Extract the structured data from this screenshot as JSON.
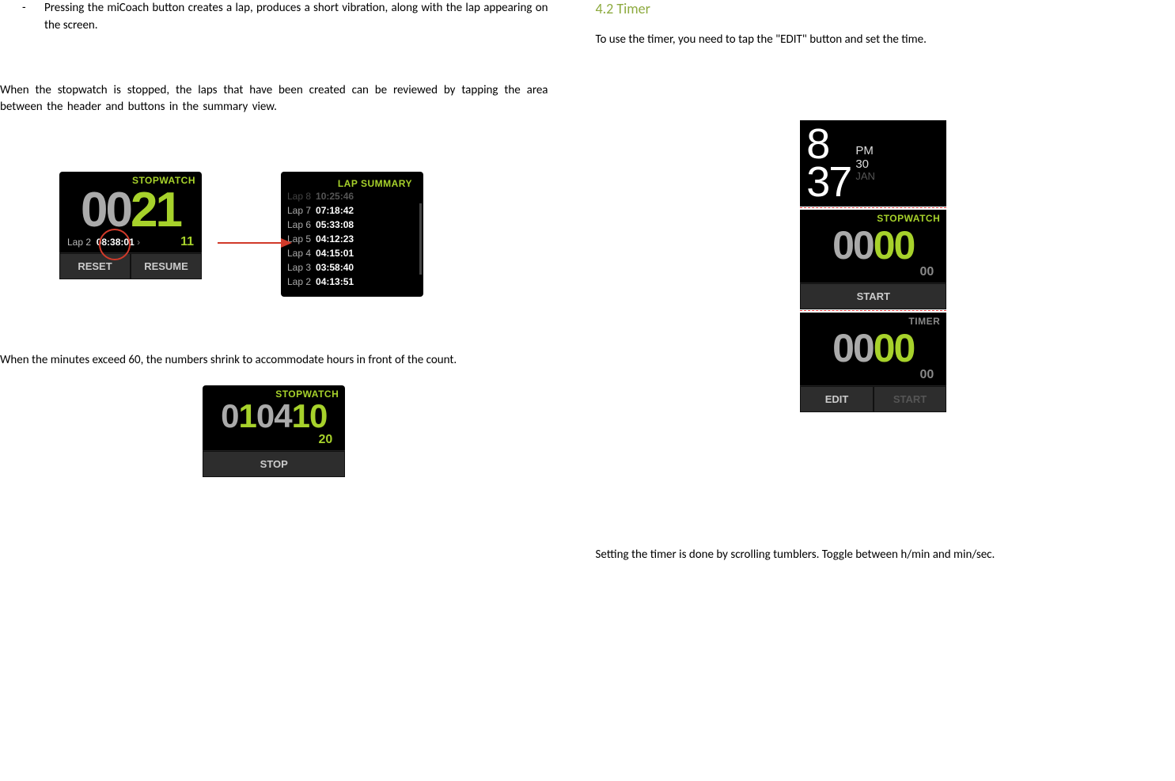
{
  "left": {
    "bullet_marker": "-",
    "bullet_text": "Pressing the miCoach button creates a lap, produces a short vibration, along with the lap appearing on the screen.",
    "para_review": "When the stopwatch is stopped, the laps that have been created can be reviewed by tapping the area between the header and buttons in the summary view.",
    "para_hours": "When the minutes exceed 60, the numbers shrink to accommodate hours in front of the count."
  },
  "stopwatch_main": {
    "header": "STOPWATCH",
    "digits_pre": "00",
    "digits_accent": "21",
    "lap_label": "Lap 2",
    "lap_time": "08:38:01",
    "sub_seconds": "11",
    "btn_left": "RESET",
    "btn_right": "RESUME"
  },
  "lap_summary": {
    "header": "LAP SUMMARY",
    "laps": [
      {
        "label": "Lap 8",
        "time": "10:25:46",
        "faded": true
      },
      {
        "label": "Lap 7",
        "time": "07:18:42"
      },
      {
        "label": "Lap 6",
        "time": "05:33:08"
      },
      {
        "label": "Lap 5",
        "time": "04:12:23"
      },
      {
        "label": "Lap 4",
        "time": "04:15:01"
      },
      {
        "label": "Lap 3",
        "time": "03:58:40"
      },
      {
        "label": "Lap 2",
        "time": "04:13:51"
      }
    ]
  },
  "stopwatch_hours": {
    "header": "STOPWATCH",
    "digits_dim1": "0",
    "digits_accent1": "1",
    "digits_dim2": "04",
    "digits_accent2": "10",
    "sub_seconds": "20",
    "btn": "STOP"
  },
  "right": {
    "section_title": "4.2 Timer",
    "intro": "To use the timer, you need to tap the \"EDIT\" button and set the time.",
    "closing": "Setting the timer is done by scrolling tumblers. Toggle between h/min and min/sec."
  },
  "clock": {
    "h": "8",
    "m": "37",
    "ampm": "PM",
    "day": "30",
    "month": "JAN"
  },
  "stopwatch_zero": {
    "header": "STOPWATCH",
    "digits_pre": "00",
    "digits_accent": "00",
    "sub_seconds": "00",
    "btn": "START"
  },
  "timer_zero": {
    "header": "TIMER",
    "digits_pre": "00",
    "digits_accent": "00",
    "sub_seconds": "00",
    "btn_left": "EDIT",
    "btn_right": "START"
  }
}
